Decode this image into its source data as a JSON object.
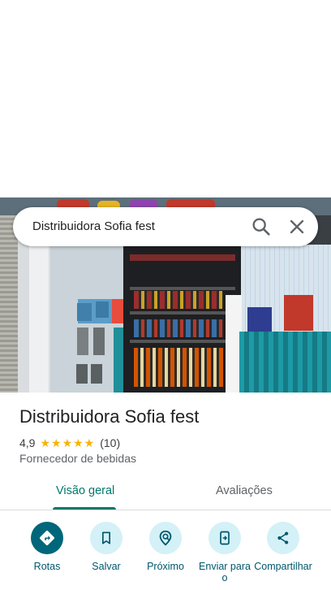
{
  "search": {
    "query": "Distribuidora Sofia fest"
  },
  "place": {
    "name": "Distribuidora Sofia fest",
    "rating": "4,9",
    "stars": "★★★★★",
    "review_count": "(10)",
    "category": "Fornecedor de bebidas"
  },
  "tabs": [
    {
      "label": "Visão geral",
      "selected": true
    },
    {
      "label": "Avaliações",
      "selected": false
    }
  ],
  "actions": [
    {
      "label": "Rotas",
      "icon": "directions-icon"
    },
    {
      "label": "Salvar",
      "icon": "bookmark-icon"
    },
    {
      "label": "Próximo",
      "icon": "nearby-icon"
    },
    {
      "label": "Enviar para o",
      "icon": "send-to-phone-icon"
    },
    {
      "label": "Compartilhar",
      "icon": "share-icon"
    }
  ],
  "colors": {
    "accent": "#00796b",
    "action_primary": "#00667a",
    "action_secondary": "#d3f1f7",
    "star": "#f6b400"
  }
}
